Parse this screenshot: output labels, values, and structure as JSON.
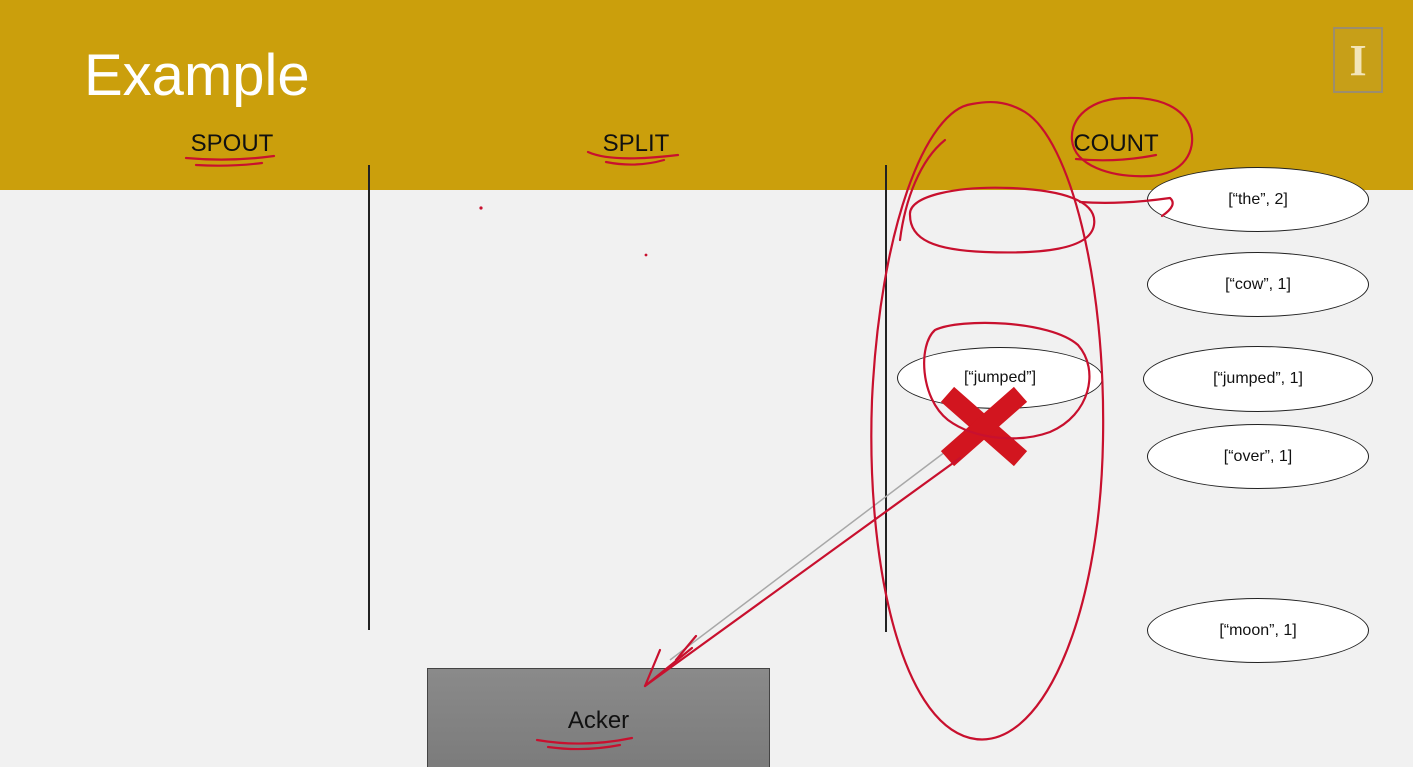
{
  "slide": {
    "title": "Example",
    "header_color": "#cb9f0c",
    "logo_glyph": "I"
  },
  "columns": {
    "spout": "SPOUT",
    "split": "SPLIT",
    "count": "COUNT"
  },
  "split_tuples": {
    "jumped": "[“jumped”]"
  },
  "count_tuples": {
    "the": "[“the”, 2]",
    "cow": "[“cow”, 1]",
    "jumped": "[“jumped”, 1]",
    "over": "[“over”, 1]",
    "moon": "[“moon”, 1]"
  },
  "acker": {
    "label": "Acker"
  },
  "annotations": {
    "ink_color": "#c8102e",
    "fail_mark": "x-mark"
  }
}
